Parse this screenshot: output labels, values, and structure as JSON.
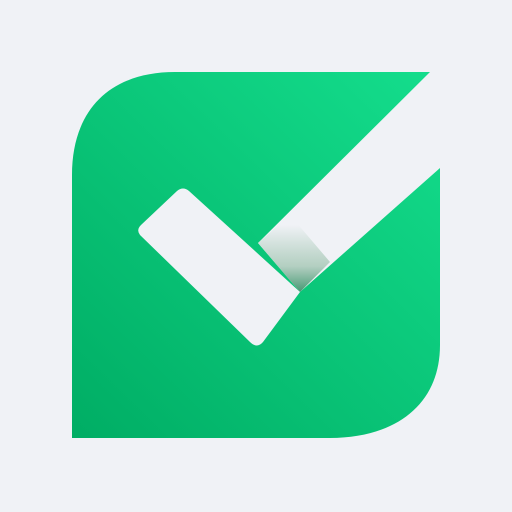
{
  "app_icon": {
    "icon_name": "checkmark-icon",
    "colors": {
      "background": "#f0f2f6",
      "tile_light": "#14dd8c",
      "tile_dark": "#00ad64",
      "checkmark": "#f0f2f6",
      "checkmark_shadow": "#0b7a48"
    }
  }
}
